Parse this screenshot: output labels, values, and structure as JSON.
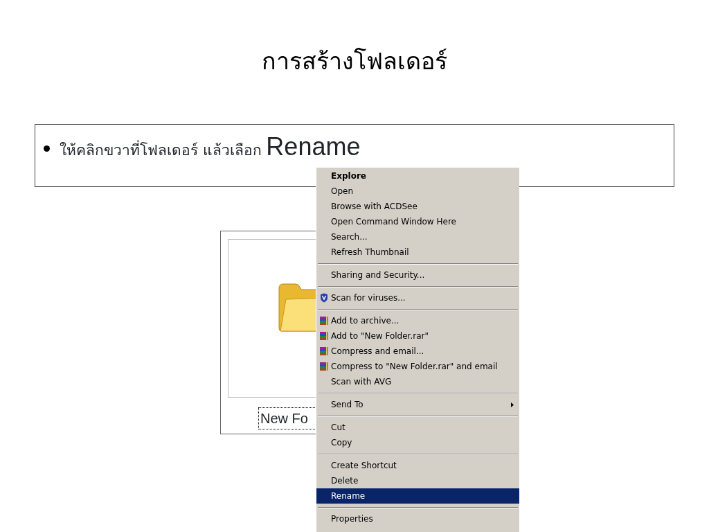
{
  "title": "การสร้างโฟลเดอร์",
  "bullet": {
    "text": "ให้คลิกขวาที่โฟลเดอร์ แล้วเลือก ",
    "emphasis": "Rename"
  },
  "folder": {
    "label": "New Fo"
  },
  "menu": {
    "groups": [
      [
        {
          "label": "Explore",
          "kind": "plain",
          "default": true,
          "selected": false
        },
        {
          "label": "Open",
          "kind": "plain",
          "default": false,
          "selected": false
        },
        {
          "label": "Browse with ACDSee",
          "kind": "plain",
          "default": false,
          "selected": false
        },
        {
          "label": "Open Command Window Here",
          "kind": "plain",
          "default": false,
          "selected": false
        },
        {
          "label": "Search...",
          "kind": "plain",
          "default": false,
          "selected": false
        },
        {
          "label": "Refresh Thumbnail",
          "kind": "plain",
          "default": false,
          "selected": false
        }
      ],
      [
        {
          "label": "Sharing and Security...",
          "kind": "plain",
          "default": false,
          "selected": false
        }
      ],
      [
        {
          "label": "Scan for viruses...",
          "kind": "shield",
          "default": false,
          "selected": false
        }
      ],
      [
        {
          "label": "Add to archive...",
          "kind": "archive",
          "default": false,
          "selected": false
        },
        {
          "label": "Add to \"New Folder.rar\"",
          "kind": "archive",
          "default": false,
          "selected": false
        },
        {
          "label": "Compress and email...",
          "kind": "archive",
          "default": false,
          "selected": false
        },
        {
          "label": "Compress to \"New Folder.rar\" and email",
          "kind": "archive",
          "default": false,
          "selected": false
        },
        {
          "label": "Scan with AVG",
          "kind": "plain",
          "default": false,
          "selected": false
        }
      ],
      [
        {
          "label": "Send To",
          "kind": "submenu",
          "default": false,
          "selected": false
        }
      ],
      [
        {
          "label": "Cut",
          "kind": "plain",
          "default": false,
          "selected": false
        },
        {
          "label": "Copy",
          "kind": "plain",
          "default": false,
          "selected": false
        }
      ],
      [
        {
          "label": "Create Shortcut",
          "kind": "plain",
          "default": false,
          "selected": false
        },
        {
          "label": "Delete",
          "kind": "plain",
          "default": false,
          "selected": false
        },
        {
          "label": "Rename",
          "kind": "plain",
          "default": false,
          "selected": true
        }
      ],
      [
        {
          "label": "Properties",
          "kind": "plain",
          "default": false,
          "selected": false
        }
      ]
    ]
  }
}
